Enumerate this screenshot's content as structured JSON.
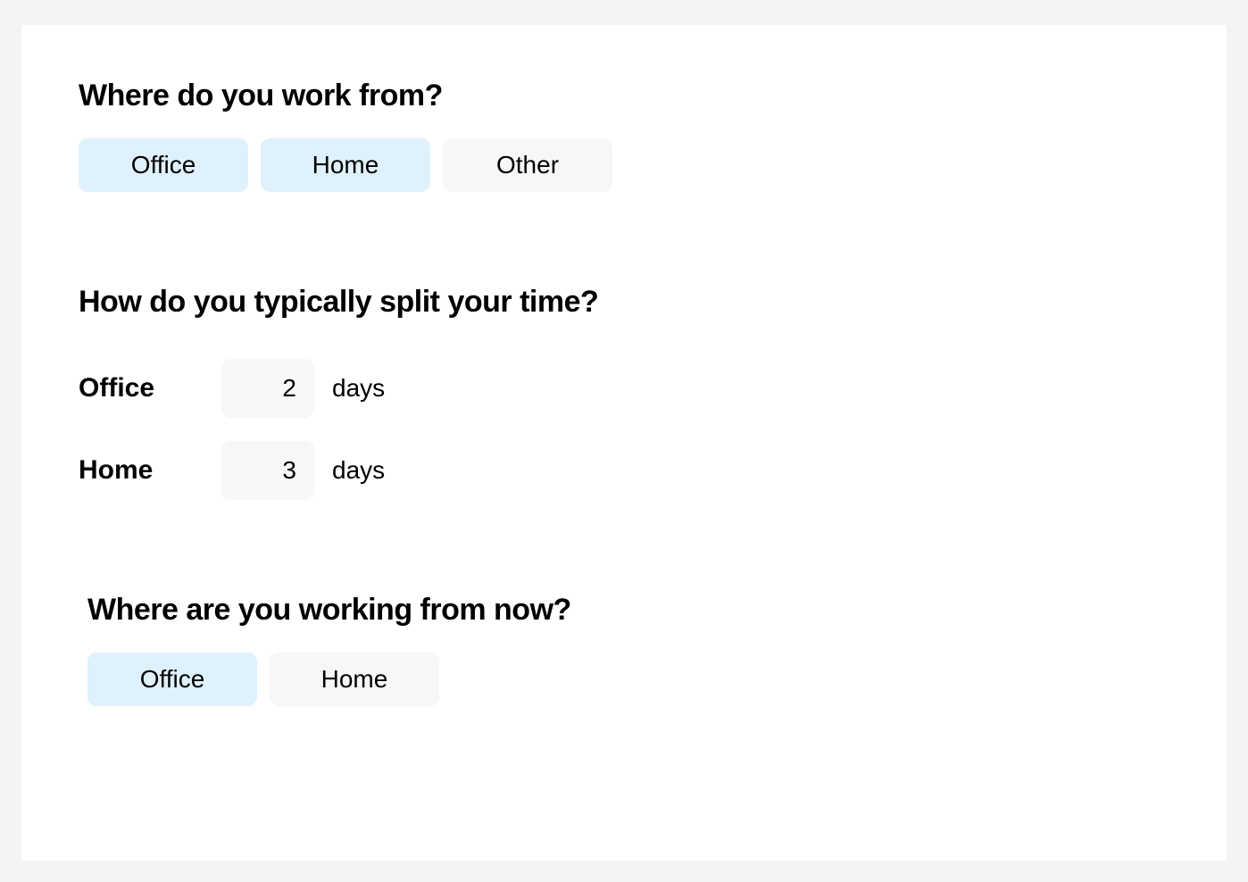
{
  "q1": {
    "title": "Where do you work from?",
    "options": [
      {
        "label": "Office",
        "selected": true
      },
      {
        "label": "Home",
        "selected": true
      },
      {
        "label": "Other",
        "selected": false
      }
    ]
  },
  "q2": {
    "title": "How do you typically split your time?",
    "rows": [
      {
        "label": "Office",
        "value": "2",
        "unit": "days"
      },
      {
        "label": "Home",
        "value": "3",
        "unit": "days"
      }
    ]
  },
  "q3": {
    "title": "Where are you working from now?",
    "options": [
      {
        "label": "Office",
        "selected": true
      },
      {
        "label": "Home",
        "selected": false
      }
    ]
  }
}
